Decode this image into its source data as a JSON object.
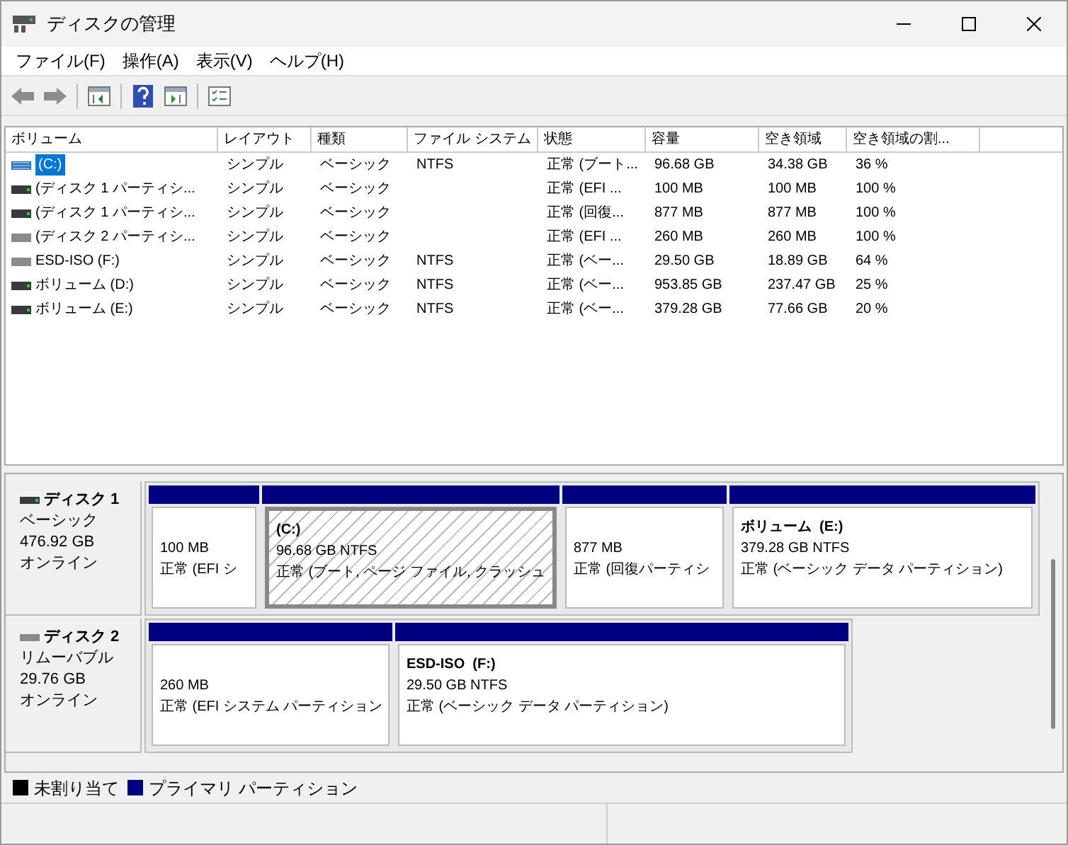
{
  "window": {
    "title": "ディスクの管理"
  },
  "menu": [
    "ファイル(F)",
    "操作(A)",
    "表示(V)",
    "ヘルプ(H)"
  ],
  "table": {
    "columns": [
      "ボリューム",
      "レイアウト",
      "種類",
      "ファイル システム",
      "状態",
      "容量",
      "空き領域",
      "空き領域の割..."
    ],
    "rows": [
      {
        "kind": "boot",
        "selected": true,
        "cells": [
          "(C:)",
          "シンプル",
          "ベーシック",
          "NTFS",
          "正常 (ブート...",
          "96.68 GB",
          "34.38 GB",
          "36 %"
        ]
      },
      {
        "kind": "fixed",
        "selected": false,
        "cells": [
          "(ディスク 1 パーティシ...",
          "シンプル",
          "ベーシック",
          "",
          "正常 (EFI ...",
          "100 MB",
          "100 MB",
          "100 %"
        ]
      },
      {
        "kind": "fixed",
        "selected": false,
        "cells": [
          "(ディスク 1 パーティシ...",
          "シンプル",
          "ベーシック",
          "",
          "正常 (回復...",
          "877 MB",
          "877 MB",
          "100 %"
        ]
      },
      {
        "kind": "removable",
        "selected": false,
        "cells": [
          "(ディスク 2 パーティシ...",
          "シンプル",
          "ベーシック",
          "",
          "正常 (EFI ...",
          "260 MB",
          "260 MB",
          "100 %"
        ]
      },
      {
        "kind": "removable",
        "selected": false,
        "cells": [
          "ESD-ISO (F:)",
          "シンプル",
          "ベーシック",
          "NTFS",
          "正常 (ベー...",
          "29.50 GB",
          "18.89 GB",
          "64 %"
        ]
      },
      {
        "kind": "fixed",
        "selected": false,
        "cells": [
          "ボリューム (D:)",
          "シンプル",
          "ベーシック",
          "NTFS",
          "正常 (ベー...",
          "953.85 GB",
          "237.47 GB",
          "25 %"
        ]
      },
      {
        "kind": "fixed",
        "selected": false,
        "cells": [
          "ボリューム (E:)",
          "シンプル",
          "ベーシック",
          "NTFS",
          "正常 (ベー...",
          "379.28 GB",
          "77.66 GB",
          "20 %"
        ]
      }
    ]
  },
  "disks": [
    {
      "kind": "fixed",
      "name": "ディスク 1",
      "type": "ベーシック",
      "size": "476.92 GB",
      "status": "オンライン",
      "partitions": [
        {
          "selected": false,
          "size": "100 MB",
          "status": "正常 (EFI シ"
        },
        {
          "selected": true,
          "label": "(C:)",
          "size": "96.68 GB NTFS",
          "status": "正常 (ブート, ページ ファイル, クラッシュ"
        },
        {
          "selected": false,
          "size": "877 MB",
          "status": "正常 (回復パーティシ"
        },
        {
          "selected": false,
          "label": "ボリューム  (E:)",
          "size": "379.28 GB NTFS",
          "status": "正常 (ベーシック データ パーティション)"
        }
      ]
    },
    {
      "kind": "removable",
      "name": "ディスク 2",
      "type": "リムーバブル",
      "size": "29.76 GB",
      "status": "オンライン",
      "partitions": [
        {
          "selected": false,
          "size": "260 MB",
          "status": "正常 (EFI システム パーティション"
        },
        {
          "selected": false,
          "label": "ESD-ISO  (F:)",
          "size": "29.50 GB NTFS",
          "status": "正常 (ベーシック データ パーティション)"
        }
      ]
    }
  ],
  "legend": [
    {
      "label": "未割り当て",
      "color": "#000000"
    },
    {
      "label": "プライマリ パーティション",
      "color": "#000080"
    }
  ]
}
